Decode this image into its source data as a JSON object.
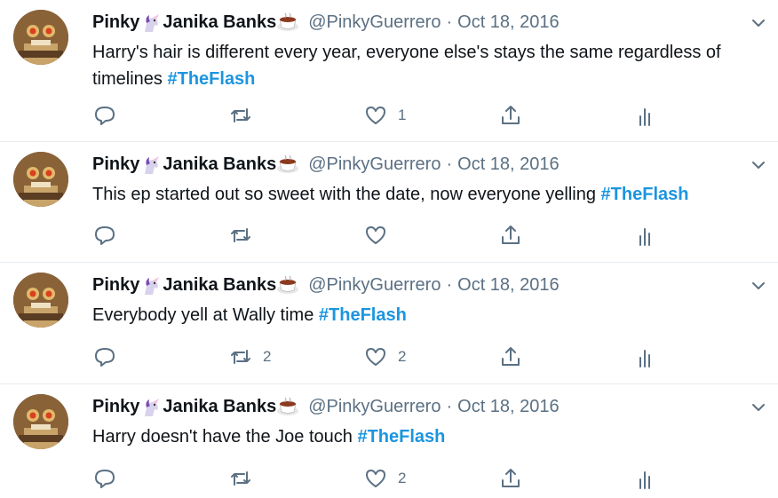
{
  "tweets": [
    {
      "name_first": "Pinky",
      "name_last": "Janika Banks",
      "handle": "@PinkyGuerrero",
      "separator": "·",
      "date": "Oct 18, 2016",
      "text": "Harry's hair is different every year, everyone else's stays the same regardless of timelines",
      "hashtag": "#TheFlash",
      "retweets": "",
      "likes": "1"
    },
    {
      "name_first": "Pinky",
      "name_last": "Janika Banks",
      "handle": "@PinkyGuerrero",
      "separator": "·",
      "date": "Oct 18, 2016",
      "text": "This ep started out so sweet with the date, now everyone yelling",
      "hashtag": "#TheFlash",
      "retweets": "",
      "likes": ""
    },
    {
      "name_first": "Pinky",
      "name_last": "Janika Banks",
      "handle": "@PinkyGuerrero",
      "separator": "·",
      "date": "Oct 18, 2016",
      "text": "Everybody yell at Wally time",
      "hashtag": "#TheFlash",
      "retweets": "2",
      "likes": "2"
    },
    {
      "name_first": "Pinky",
      "name_last": "Janika Banks",
      "handle": "@PinkyGuerrero",
      "separator": "·",
      "date": "Oct 18, 2016",
      "text": "Harry doesn't have the Joe touch",
      "hashtag": "#TheFlash",
      "retweets": "",
      "likes": "2"
    }
  ],
  "colors": {
    "hashtag": "#1b95e0",
    "secondary_text": "#5b7083",
    "divider": "#e6ecf0"
  },
  "icons": [
    "avatar-image",
    "unicorn-icon",
    "coffee-icon",
    "chevron-down-icon",
    "reply-icon",
    "retweet-icon",
    "like-icon",
    "share-icon",
    "analytics-icon"
  ]
}
